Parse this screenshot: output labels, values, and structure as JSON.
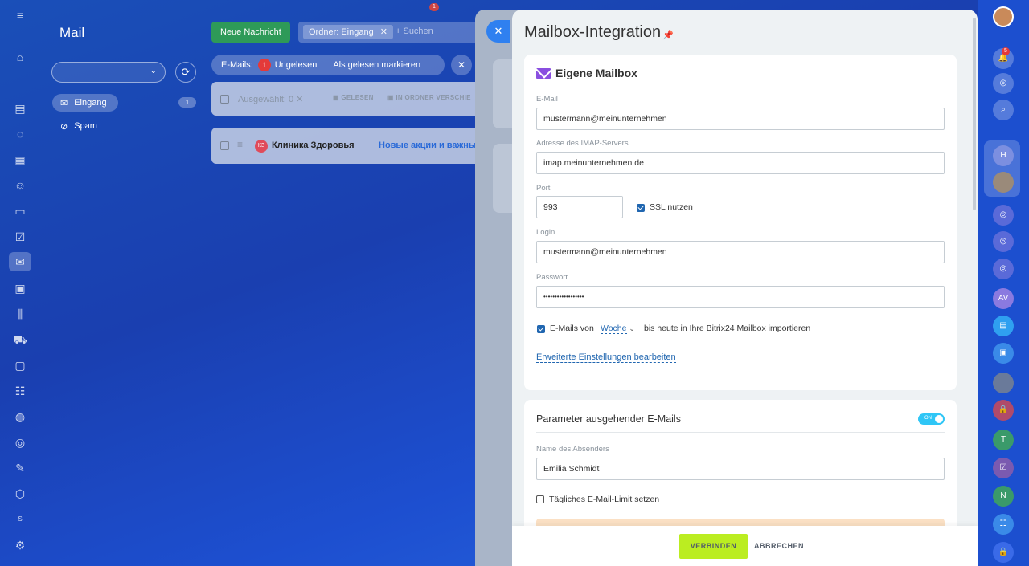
{
  "colors": {
    "accent": "#2066b0",
    "connect_button": "#bbed21",
    "new_message_button": "#2e9a58",
    "badge": "#e43a3a",
    "toggle": "#2fc6f6"
  },
  "left_rail": {
    "icons": [
      "menu-icon",
      "home-icon",
      "feed-icon",
      "chat-icon",
      "calendar-icon",
      "contacts-icon",
      "documents-icon",
      "tasks-icon",
      "mail-icon",
      "board-icon",
      "analytics-icon",
      "cart-icon",
      "contact-center-icon",
      "timeline-icon",
      "automation-icon",
      "goals-icon",
      "forms-icon",
      "integrations-icon",
      "settings-icon"
    ],
    "small_letter": "S"
  },
  "mail": {
    "title": "Mail",
    "new_message": "Neue Nachricht",
    "filter_chip": "Ordner: Eingang",
    "search_placeholder": "+ Suchen",
    "counter_label": "E-Mails:",
    "unread_count": "1",
    "unread_label": "Ungelesen",
    "mark_read": "Als gelesen markieren",
    "folders": [
      {
        "label": "Eingang",
        "count": "1"
      },
      {
        "label": "Spam"
      }
    ],
    "selected_label": "Ausgewählt: 0",
    "action_read": "GELESEN",
    "action_move": "IN ORDNER VERSCHIE",
    "row": {
      "avatar": "КЗ",
      "sender": "Клиника Здоровья",
      "subject": "Новые акции и важные"
    }
  },
  "panel": {
    "title": "Mailbox-Integration",
    "section1_title": "Eigene Mailbox",
    "email_label": "E-Mail",
    "email_value": "mustermann@meinunternehmen",
    "imap_label": "Adresse des IMAP-Servers",
    "imap_value": "imap.meinunternehmen.de",
    "port_label": "Port",
    "port_value": "993",
    "ssl_label": "SSL nutzen",
    "login_label": "Login",
    "login_value": "mustermann@meinunternehmen",
    "password_label": "Passwort",
    "password_value": "••••••••••••••••••",
    "import_prefix": "E-Mails von",
    "import_period": "Woche",
    "import_suffix": "bis heute in Ihre Bitrix24 Mailbox importieren",
    "advanced_link": "Erweiterte Einstellungen bearbeiten",
    "section2_title": "Parameter ausgehender E-Mails",
    "toggle_label": "ON",
    "sender_name_label": "Name des Absenders",
    "sender_name_value": "Emilia Schmidt",
    "daily_limit_label": "Tägliches E-Mail-Limit setzen",
    "connect_button": "VERBINDEN",
    "cancel_button": "ABBRECHEN"
  },
  "right_rail": {
    "bell_badge": "5",
    "items": [
      "H",
      "AV",
      "T",
      "N"
    ]
  },
  "top_badge": "1"
}
